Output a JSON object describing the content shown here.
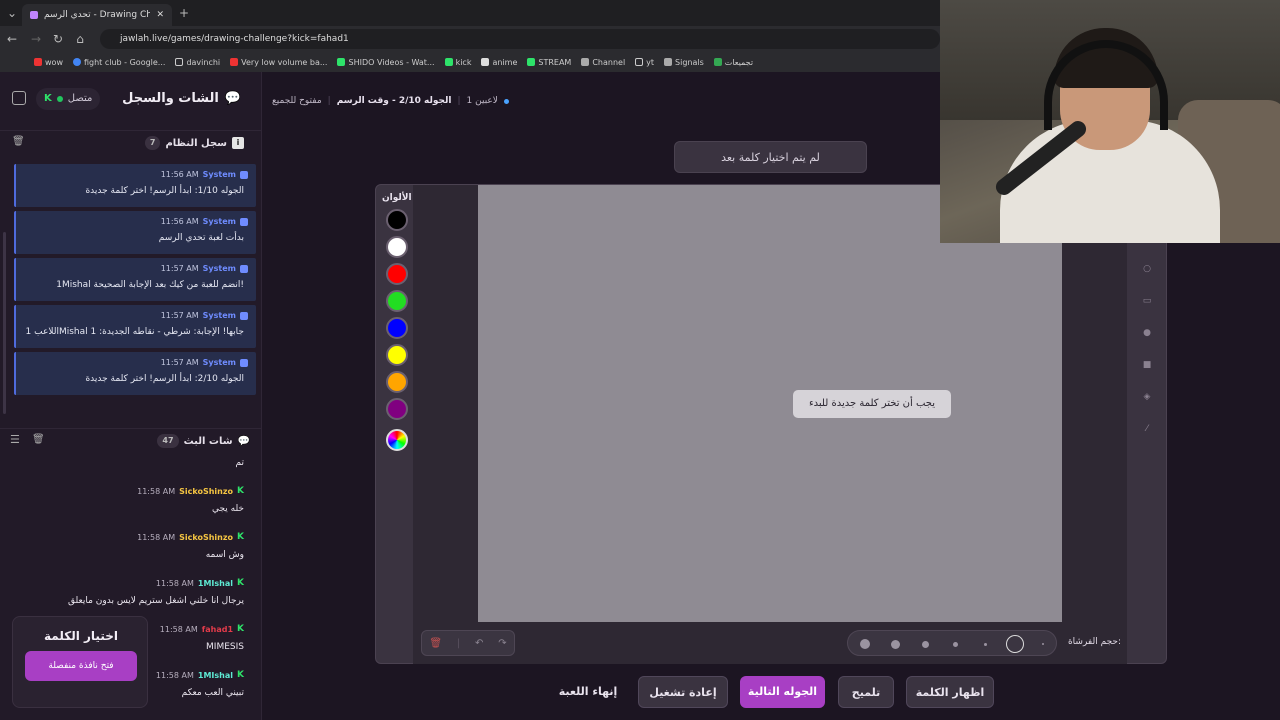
{
  "browser": {
    "tab_title": "تحدي الرسم - Drawing Challenge",
    "url": "jawlah.live/games/drawing-challenge?kick=fahad1",
    "bookmarks": [
      "wow",
      "fight club - Google...",
      "davinchi",
      "Very low volume ba...",
      "SHIDO Videos - Wat...",
      "kick",
      "anime",
      "STREAM",
      "Channel",
      "yt",
      "Signals",
      "تجميعات"
    ]
  },
  "sidebar": {
    "title": "الشات والسجل",
    "connection": "متصل",
    "system_log": {
      "title": "سجل النظام",
      "count": "7",
      "items": [
        {
          "name": "System",
          "time": "11:56 AM",
          "msg": "الجوله 1/10: ابدأ الرسم! اختر كلمة جديدة"
        },
        {
          "name": "System",
          "time": "11:56 AM",
          "msg": "بدأت لعبة تحدي الرسم"
        },
        {
          "name": "System",
          "time": "11:57 AM",
          "msg": "1Mishal انضم للعبة من كيك بعد الإجابة الصحيحة!"
        },
        {
          "name": "System",
          "time": "11:57 AM",
          "msg": "اللاعب 1Mishal جابها! الإجابة: شرطي - نقاطه الجديدة: 1"
        },
        {
          "name": "System",
          "time": "11:57 AM",
          "msg": "الجوله 2/10: ابدأ الرسم! اختر كلمة جديدة"
        }
      ]
    },
    "stream_chat": {
      "title": "شات البث",
      "count": "47",
      "items": [
        {
          "user": "",
          "time": "",
          "msg": "تم",
          "color": "#ffffff"
        },
        {
          "user": "SickoShinzo",
          "time": "11:58 AM",
          "msg": "خله يجي",
          "color": "#f5c542"
        },
        {
          "user": "SickoShinzo",
          "time": "11:58 AM",
          "msg": "وش اسمه",
          "color": "#f5c542"
        },
        {
          "user": "1MIshal",
          "time": "11:58 AM",
          "msg": "يرجال انا خلني اشغل ستريم لايس بدون مايعلق",
          "color": "#5eead4"
        },
        {
          "user": "fahad1",
          "time": "11:58 AM",
          "msg": "MIMESIS",
          "color": "#e23b4a"
        },
        {
          "user": "1MIshal",
          "time": "11:58 AM",
          "msg": "تبيني العب معكم",
          "color": "#5eead4"
        }
      ]
    },
    "word_card": {
      "title": "اختيار الكلمة",
      "button": "فتح نافذة منفصلة"
    }
  },
  "main": {
    "players": "1 لاعبين",
    "round": "الجوله 2/10 - وقت الرسم",
    "mode": "مفتوح للجميع",
    "word_status": "لم يتم اختيار كلمة بعد",
    "palette_label": "الألوان",
    "colors": [
      "#000000",
      "#ffffff",
      "#ff0000",
      "#22dd22",
      "#0000ff",
      "#ffff00",
      "#ffa500",
      "#800080"
    ],
    "canvas_hint": "يجب أن تختر كلمة جديدة للبدء",
    "brush_label": "حجم الفرشاة:",
    "actions": {
      "end_game": "إنهاء اللعبة",
      "restart": "إعادة تشغيل",
      "next_round": "الجوله التالية",
      "hint": "تلميح",
      "reveal_word": "اظهار الكلمة"
    }
  }
}
